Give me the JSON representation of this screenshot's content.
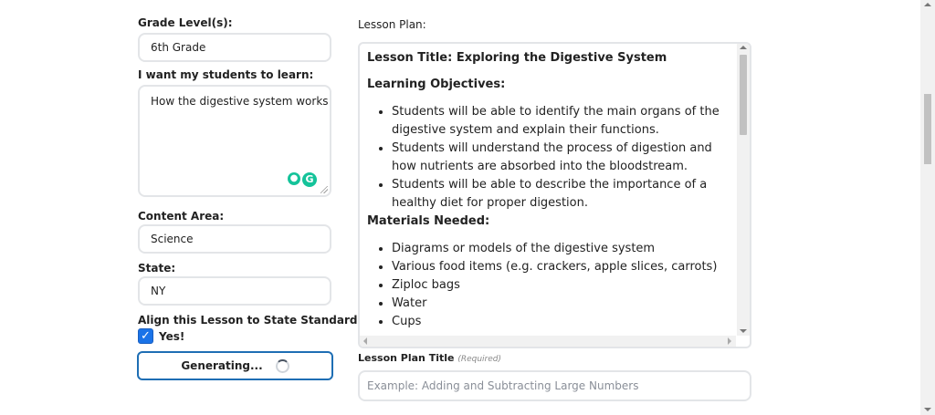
{
  "form": {
    "grade_label": "Grade Level(s):",
    "grade_value": "6th Grade",
    "learn_label": "I want my students to learn:",
    "learn_value": "How the digestive system works",
    "content_label": "Content Area:",
    "content_value": "Science",
    "state_label": "State:",
    "state_value": "NY",
    "align_label": "Align this Lesson to State Standards?",
    "align_checked": true,
    "align_yes": "Yes!",
    "generate_label": "Generating..."
  },
  "plan": {
    "label": "Lesson Plan:",
    "title_line": "Lesson Title: Exploring the Digestive System",
    "objectives_heading": "Learning Objectives:",
    "objectives": [
      "Students will be able to identify the main organs of the digestive system and explain their functions.",
      "Students will understand the process of digestion and how nutrients are absorbed into the bloodstream.",
      "Students will be able to describe the importance of a healthy diet for proper digestion."
    ],
    "materials_heading": "Materials Needed:",
    "materials": [
      "Diagrams or models of the digestive system",
      "Various food items (e.g. crackers, apple slices, carrots)",
      "Ziploc bags",
      "Water",
      "Cups"
    ]
  },
  "title_field": {
    "label": "Lesson Plan Title",
    "required": "(Required)",
    "placeholder": "Example: Adding and Subtracting Large Numbers"
  },
  "icons": {
    "checkbox": "checkmark-icon",
    "grammarly": "grammarly-icon",
    "bulb": "lightbulb-icon"
  },
  "colors": {
    "button_border": "#1e6eb4",
    "checkbox": "#1a73e8",
    "extension": "#15c39a"
  }
}
